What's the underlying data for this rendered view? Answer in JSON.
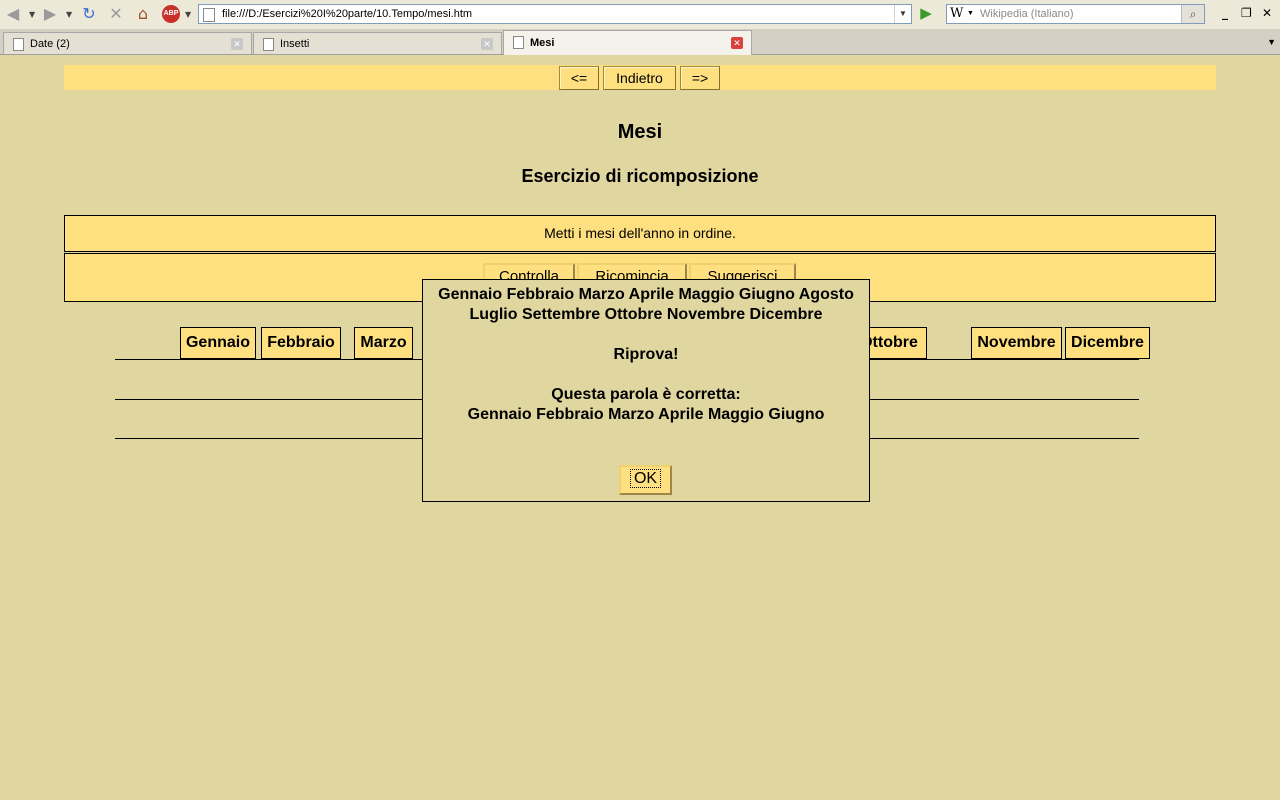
{
  "browser": {
    "url": "file:///D:/Esercizi%20I%20parte/10.Tempo/mesi.htm",
    "search_engine_icon": "W",
    "search_placeholder": "Wikipedia (Italiano)",
    "abp_label": "ABP",
    "tabs": [
      {
        "label": "Date (2)"
      },
      {
        "label": "Insetti"
      },
      {
        "label": "Mesi"
      }
    ]
  },
  "page": {
    "nav": {
      "prev": "<=",
      "back": "Indietro",
      "next": "=>"
    },
    "title": "Mesi",
    "subtitle": "Esercizio di ricomposizione",
    "instruction": "Metti i mesi dell'anno in ordine.",
    "actions": {
      "check": "Controlla",
      "restart": "Ricomincia",
      "hint": "Suggerisci"
    },
    "words": [
      "Gennaio",
      "Febbraio",
      "Marzo",
      "Ottobre",
      "Novembre",
      "Dicembre"
    ]
  },
  "dialog": {
    "answer_line1": "Gennaio Febbraio Marzo Aprile Maggio Giugno Agosto",
    "answer_line2": "Luglio Settembre Ottobre Novembre Dicembre",
    "result": "Riprova!",
    "correct_label": "Questa parola è corretta:",
    "correct_part": "Gennaio Febbraio Marzo Aprile Maggio Giugno",
    "ok_label": "OK"
  }
}
